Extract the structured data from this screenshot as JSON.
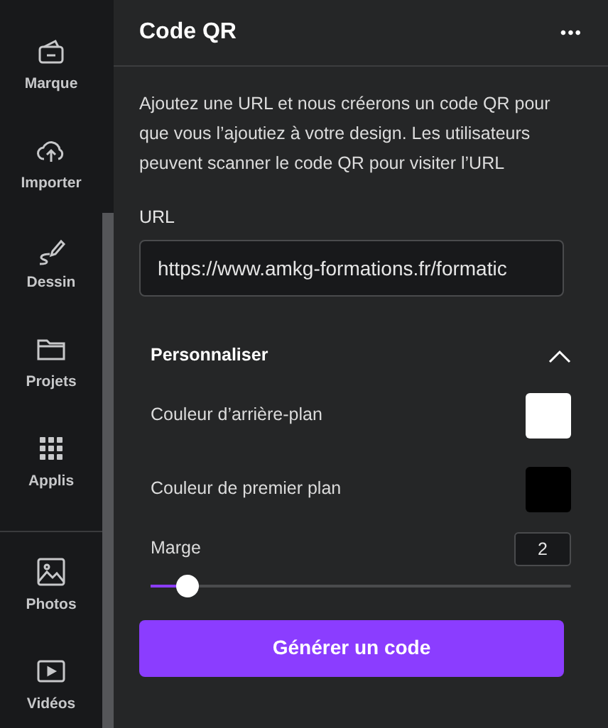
{
  "sidebar": {
    "groups": [
      [
        {
          "label": "Marque"
        },
        {
          "label": "Importer"
        },
        {
          "label": "Dessin"
        },
        {
          "label": "Projets"
        },
        {
          "label": "Applis"
        }
      ],
      [
        {
          "label": "Photos"
        },
        {
          "label": "Vidéos"
        }
      ]
    ]
  },
  "panel": {
    "title": "Code QR",
    "more": "•••",
    "description": "Ajoutez une URL et nous créerons un code QR pour que vous l’ajoutiez à votre design. Les utilisateurs peuvent scanner le code QR pour visiter l’URL",
    "url_label": "URL",
    "url_value": "https://www.amkg-formations.fr/formatic",
    "customize": {
      "title": "Personnaliser",
      "expanded": true,
      "colors": [
        {
          "label": "Couleur d’arrière-plan",
          "color": "#ffffff"
        },
        {
          "label": "Couleur de premier plan",
          "color": "#000000"
        }
      ],
      "margin": {
        "label": "Marge",
        "value": "2",
        "level": 0.07
      }
    },
    "button": "Générer un code"
  }
}
